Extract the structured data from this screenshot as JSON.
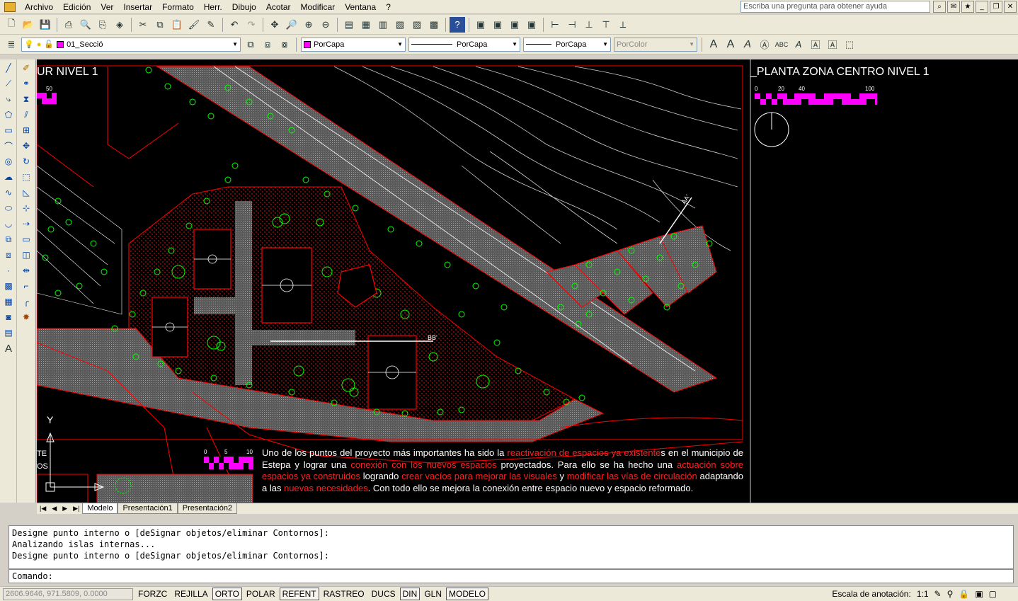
{
  "menu": [
    "Archivo",
    "Edición",
    "Ver",
    "Insertar",
    "Formato",
    "Herr.",
    "Dibujo",
    "Acotar",
    "Modificar",
    "Ventana",
    "?"
  ],
  "help_placeholder": "Escriba una pregunta para obtener ayuda",
  "layer": {
    "name": "01_Secció",
    "color": "#ff00ff"
  },
  "properties": {
    "color": "PorCapa",
    "linetype": "PorCapa",
    "lineweight": "PorCapa",
    "plotstyle": "PorColor"
  },
  "drawing": {
    "title_left": "UR NIVEL 1",
    "title_right": "_PLANTA ZONA CENTRO NIVEL 1",
    "scale_left_label": "50",
    "scale_right_labels": [
      "0",
      "20",
      "40",
      "100"
    ],
    "scale_small_labels": [
      "0",
      "5",
      "10"
    ],
    "section_labels": [
      "AA'",
      "BB'"
    ],
    "cut_label_1": "TE",
    "cut_label_2": "OS",
    "axis_y": "Y",
    "description": [
      {
        "t": "Uno de los puntos del proyecto más importantes ha sido la ",
        "r": false
      },
      {
        "t": "reactivación de espacios ya existente",
        "r": true
      },
      {
        "t": "s en el municipio de Estepa y lograr una ",
        "r": false
      },
      {
        "t": "conexión con los nuevos espacios",
        "r": true
      },
      {
        "t": " proyectados. Para ello se ha hecho una ",
        "r": false
      },
      {
        "t": "actuación sobre espacios ya construidos",
        "r": true
      },
      {
        "t": " logrando ",
        "r": false
      },
      {
        "t": "crear vacíos para mejorar las visuales",
        "r": true
      },
      {
        "t": " y ",
        "r": false
      },
      {
        "t": "modificar las vías de circulación",
        "r": true
      },
      {
        "t": " adaptando a las ",
        "r": false
      },
      {
        "t": "nuevas necesidades",
        "r": true
      },
      {
        "t": ". Con todo ello se mejora la conexión entre espacio nuevo y espacio reformado.",
        "r": false
      }
    ]
  },
  "layout_tabs": [
    "Modelo",
    "Presentación1",
    "Presentación2"
  ],
  "command_history": [
    "Designe punto interno o [deSignar objetos/eliminar Contornos]:",
    "Analizando islas internas...",
    "Designe punto interno o [deSignar objetos/eliminar Contornos]:"
  ],
  "command_prompt": "Comando:",
  "status": {
    "coords": "2606.9646, 971.5809, 0.0000",
    "toggles": [
      {
        "label": "FORZC",
        "on": false
      },
      {
        "label": "REJILLA",
        "on": false
      },
      {
        "label": "ORTO",
        "on": true
      },
      {
        "label": "POLAR",
        "on": false
      },
      {
        "label": "REFENT",
        "on": true
      },
      {
        "label": "RASTREO",
        "on": false
      },
      {
        "label": "DUCS",
        "on": false
      },
      {
        "label": "DIN",
        "on": true
      },
      {
        "label": "GLN",
        "on": false
      },
      {
        "label": "MODELO",
        "on": true
      }
    ],
    "annotation_scale_label": "Escala de anotación:",
    "annotation_scale": "1:1"
  },
  "colors": {
    "canvas": "#000000",
    "accent": "#ff00ff",
    "red": "#ff0000",
    "green": "#00ff00"
  }
}
